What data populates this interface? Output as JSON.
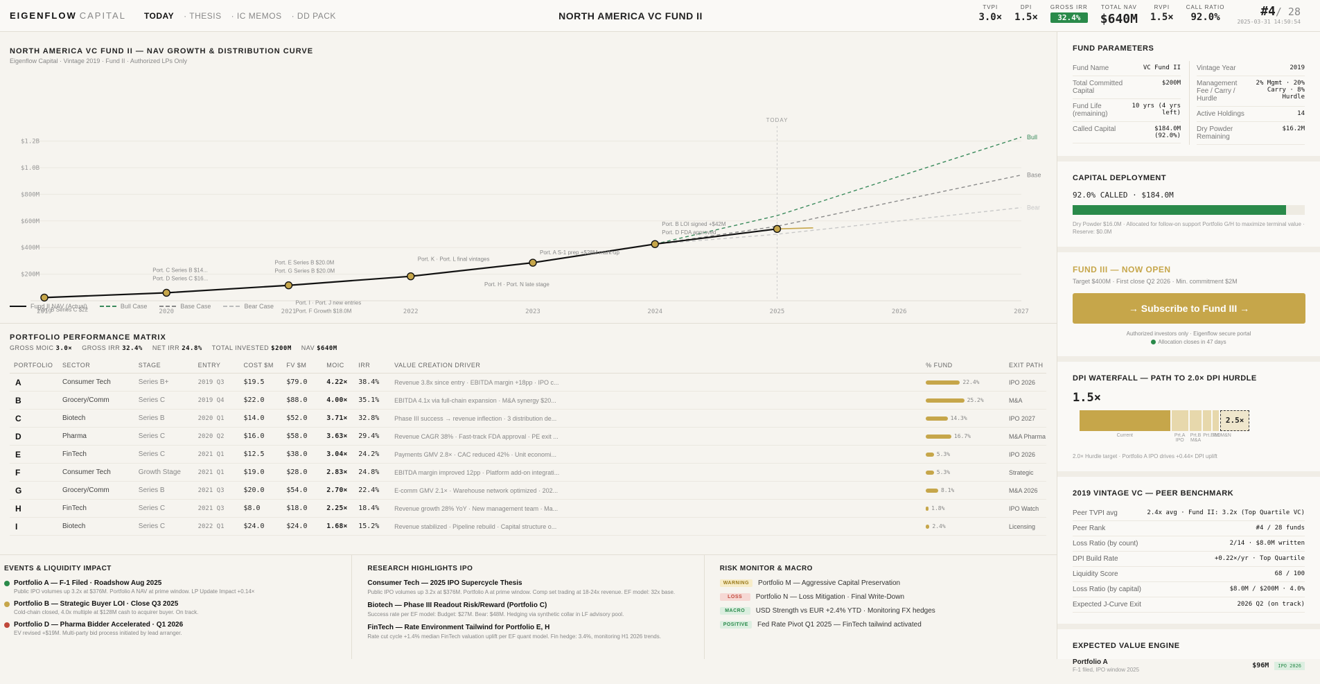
{
  "header": {
    "brand": "EIGENFLOW",
    "brand_sub": "CAPITAL",
    "nav": [
      "TODAY",
      "· THESIS",
      "· IC MEMOS",
      "· DD PACK"
    ],
    "fund_title": "NORTH AMERICA VC FUND II",
    "metrics": [
      {
        "label": "TVPI",
        "value": "3.0×"
      },
      {
        "label": "DPI",
        "value": "1.5×"
      },
      {
        "label": "GROSS IRR",
        "value": "32.4%"
      },
      {
        "label": "TOTAL NAV",
        "value": "$640M"
      },
      {
        "label": "RVPI",
        "value": "1.5×"
      },
      {
        "label": "CALL RATIO",
        "value": "92.0%"
      }
    ],
    "rank": "#4",
    "rank_of": "/ 28",
    "timestamp": "2025-03-31 14:50:54"
  },
  "chart": {
    "title": "NORTH AMERICA VC FUND II — NAV GROWTH & DISTRIBUTION CURVE",
    "subtitle": "Eigenflow Capital · Vintage 2019 · Fund II · Authorized LPs Only",
    "today_label": "TODAY",
    "legend": [
      "Fund II NAV (Actual)",
      "Bull Case",
      "Base Case",
      "Bear Case"
    ]
  },
  "chart_data": {
    "type": "line",
    "x": [
      2019,
      2020,
      2021,
      2022,
      2023,
      2024,
      2025
    ],
    "series": [
      {
        "name": "Fund II NAV (Actual)",
        "x": [
          2019,
          2020,
          2021,
          2022,
          2023,
          2024,
          2025
        ],
        "values": [
          24,
          60,
          116,
          184,
          286,
          426,
          540
        ]
      },
      {
        "name": "Bull",
        "x": [
          2024,
          2025,
          2027
        ],
        "values": [
          426,
          640,
          1230
        ]
      },
      {
        "name": "Base",
        "x": [
          2024,
          2025,
          2027
        ],
        "values": [
          426,
          560,
          945
        ]
      },
      {
        "name": "Bear",
        "x": [
          2024,
          2025,
          2027
        ],
        "values": [
          426,
          500,
          700
        ]
      }
    ],
    "yticks": [
      "$200M",
      "$400M",
      "$600M",
      "$800M",
      "$1.0B",
      "$1.2B"
    ],
    "ytick_values": [
      200,
      400,
      600,
      800,
      1000,
      1200
    ],
    "xticks": [
      "2019",
      "2020",
      "2021",
      "2022",
      "2023",
      "2024",
      "2025",
      "2026",
      "2027"
    ],
    "xlim": [
      2019,
      2027
    ],
    "ylim": [
      0,
      1250
    ],
    "today_x": 2025,
    "annotations": [
      {
        "x": 2019,
        "lines": [
          "Port. B Series C $22"
        ],
        "side": "below"
      },
      {
        "x": 2020,
        "lines": [
          "Port. C Series B $14...",
          "Port. D Series C $16..."
        ],
        "side": "above"
      },
      {
        "x": 2021,
        "lines": [
          "Port. E Series B $20.0M",
          "Port. G Series B $20.0M"
        ],
        "side": "above"
      },
      {
        "x": 2021,
        "lines": [
          "Port. I · Port. J new entries",
          "Port. F Growth $18.0M"
        ],
        "side": "below"
      },
      {
        "x": 2022,
        "lines": [
          "Port. K · Port. L final vintages"
        ],
        "side": "above"
      },
      {
        "x": 2023,
        "lines": [
          "Port. H · Port. N late stage"
        ],
        "side": "below"
      },
      {
        "x": 2023,
        "lines": [
          "Port. A S-1 prep +$28M mark-up"
        ],
        "side": "above"
      },
      {
        "x": 2024,
        "lines": [
          "Port. B LOI signed +$42M",
          "Port. D FDA approved"
        ],
        "side": "above"
      }
    ],
    "bull_label": "Bull",
    "base_label": "Base",
    "bear_label": "Bear"
  },
  "matrix": {
    "title": "PORTFOLIO PERFORMANCE MATRIX",
    "summary": [
      {
        "k": "GROSS MOIC",
        "v": "3.0×"
      },
      {
        "k": "GROSS IRR",
        "v": "32.4%"
      },
      {
        "k": "NET IRR",
        "v": "24.8%"
      },
      {
        "k": "TOTAL INVESTED",
        "v": "$200M"
      },
      {
        "k": "NAV",
        "v": "$640M"
      }
    ],
    "headers": [
      "PORTFOLIO",
      "SECTOR",
      "STAGE",
      "ENTRY",
      "COST $M",
      "FV $M",
      "MOIC",
      "IRR",
      "VALUE CREATION DRIVER",
      "% FUND",
      "EXIT PATH"
    ],
    "rows": [
      {
        "p": "A",
        "sector": "Consumer Tech",
        "stage": "Series B+",
        "entry": "2019 Q3",
        "cost": "$19.5",
        "fv": "$79.0",
        "moic": "4.22×",
        "irr": "38.4%",
        "driver": "Revenue 3.8x since entry · EBITDA margin +18pp · IPO c...",
        "pct": "22.4%",
        "pct_val": 22.4,
        "exit": "IPO 2026"
      },
      {
        "p": "B",
        "sector": "Grocery/Comm",
        "stage": "Series C",
        "entry": "2019 Q4",
        "cost": "$22.0",
        "fv": "$88.0",
        "moic": "4.00×",
        "irr": "35.1%",
        "driver": "EBITDA 4.1x via full-chain expansion · M&A synergy $20...",
        "pct": "25.2%",
        "pct_val": 25.2,
        "exit": "M&A"
      },
      {
        "p": "C",
        "sector": "Biotech",
        "stage": "Series B",
        "entry": "2020 Q1",
        "cost": "$14.0",
        "fv": "$52.0",
        "moic": "3.71×",
        "irr": "32.8%",
        "driver": "Phase III success → revenue inflection · 3 distribution de...",
        "pct": "14.3%",
        "pct_val": 14.3,
        "exit": "IPO 2027"
      },
      {
        "p": "D",
        "sector": "Pharma",
        "stage": "Series C",
        "entry": "2020 Q2",
        "cost": "$16.0",
        "fv": "$58.0",
        "moic": "3.63×",
        "irr": "29.4%",
        "driver": "Revenue CAGR 38% · Fast-track FDA approval · PE exit ...",
        "pct": "16.7%",
        "pct_val": 16.7,
        "exit": "M&A Pharma"
      },
      {
        "p": "E",
        "sector": "FinTech",
        "stage": "Series C",
        "entry": "2021 Q1",
        "cost": "$12.5",
        "fv": "$38.0",
        "moic": "3.04×",
        "irr": "24.2%",
        "driver": "Payments GMV 2.8× · CAC reduced 42% · Unit economi...",
        "pct": "5.3%",
        "pct_val": 5.3,
        "exit": "IPO 2026"
      },
      {
        "p": "F",
        "sector": "Consumer Tech",
        "stage": "Growth Stage",
        "entry": "2021 Q1",
        "cost": "$19.0",
        "fv": "$28.0",
        "moic": "2.83×",
        "irr": "24.8%",
        "driver": "EBITDA margin improved 12pp · Platform add-on integrati...",
        "pct": "5.3%",
        "pct_val": 5.3,
        "exit": "Strategic"
      },
      {
        "p": "G",
        "sector": "Grocery/Comm",
        "stage": "Series B",
        "entry": "2021 Q3",
        "cost": "$20.0",
        "fv": "$54.0",
        "moic": "2.70×",
        "irr": "22.4%",
        "driver": "E-comm GMV 2.1× · Warehouse network optimized · 202...",
        "pct": "8.1%",
        "pct_val": 8.1,
        "exit": "M&A 2026"
      },
      {
        "p": "H",
        "sector": "FinTech",
        "stage": "Series C",
        "entry": "2021 Q3",
        "cost": "$8.0",
        "fv": "$18.0",
        "moic": "2.25×",
        "irr": "18.4%",
        "driver": "Revenue growth 28% YoY · New management team · Ma...",
        "pct": "1.8%",
        "pct_val": 1.8,
        "exit": "IPO Watch"
      },
      {
        "p": "I",
        "sector": "Biotech",
        "stage": "Series C",
        "entry": "2022 Q1",
        "cost": "$24.0",
        "fv": "$24.0",
        "moic": "1.68×",
        "irr": "15.2%",
        "driver": "Revenue stabilized · Pipeline rebuild · Capital structure o...",
        "pct": "2.4%",
        "pct_val": 2.4,
        "exit": "Licensing"
      }
    ]
  },
  "events": {
    "title": "EVENTS & LIQUIDITY IMPACT",
    "items": [
      {
        "color": "#2a8a4a",
        "t": "Portfolio A — F-1 Filed · Roadshow Aug 2025",
        "s": "Public IPO volumes up 3.2x at $376M. Portfolio A NAV at prime window. LP Update Impact +0.14×"
      },
      {
        "color": "#c6a64a",
        "t": "Portfolio B — Strategic Buyer LOI · Close Q3 2025",
        "s": "Cold-chain closed, 4.0x multiple at $128M cash to acquirer buyer. On track."
      },
      {
        "color": "#c0483a",
        "t": "Portfolio D — Pharma Bidder Accelerated · Q1 2026",
        "s": "EV revised +$19M. Multi-party bid process initiated by lead arranger."
      }
    ]
  },
  "research": {
    "title": "RESEARCH HIGHLIGHTS IPO",
    "items": [
      {
        "t": "Consumer Tech — 2025 IPO Supercycle Thesis",
        "s": "Public IPO volumes up 3.2x at $376M. Portfolio A at prime window. Comp set trading at 18-24x revenue. EF model: 32x base."
      },
      {
        "t": "Biotech — Phase III Readout Risk/Reward (Portfolio C)",
        "s": "Success rate per EF model: Budget: $27M. Bear: $48M. Hedging via synthetic collar in LF advisory pool."
      },
      {
        "t": "FinTech — Rate Environment Tailwind for Portfolio E, H",
        "s": "Rate cut cycle +1.4% median FinTech valuation uplift per EF quant model. Fin hedge: 3.4%, monitoring H1 2026 trends."
      }
    ]
  },
  "risk": {
    "title": "RISK MONITOR & MACRO",
    "items": [
      {
        "tag": "WARNING",
        "bg": "#f7ecc8",
        "fg": "#9a7a1a",
        "t": "Portfolio M — Aggressive Capital Preservation"
      },
      {
        "tag": "LOSS",
        "bg": "#f6d8d4",
        "fg": "#c0483a",
        "t": "Portfolio N — Loss Mitigation · Final Write-Down"
      },
      {
        "tag": "MACRO",
        "bg": "#dceee0",
        "fg": "#2a8a4a",
        "t": "USD Strength vs EUR +2.4% YTD · Monitoring FX hedges"
      },
      {
        "tag": "POSITIVE",
        "bg": "#dceee0",
        "fg": "#2a8a4a",
        "t": "Fed Rate Pivot Q1 2025 — FinTech tailwind activated"
      }
    ]
  },
  "params": {
    "title": "FUND PARAMETERS",
    "left": [
      {
        "k": "Fund Name",
        "v": "VC Fund II"
      },
      {
        "k": "Total Committed Capital",
        "v": "$200M"
      },
      {
        "k": "Fund Life (remaining)",
        "v": "10 yrs (4 yrs left)"
      },
      {
        "k": "Called Capital",
        "v": "$184.0M (92.0%)"
      }
    ],
    "right": [
      {
        "k": "Vintage Year",
        "v": "2019"
      },
      {
        "k": "Management Fee / Carry / Hurdle",
        "v": "2% Mgmt · 20% Carry · 8% Hurdle"
      },
      {
        "k": "Active Holdings",
        "v": "14"
      },
      {
        "k": "Dry Powder Remaining",
        "v": "$16.2M"
      }
    ]
  },
  "deployment": {
    "title": "CAPITAL DEPLOYMENT",
    "label": "92.0% CALLED · $184.0M",
    "pct": 92,
    "note": "Dry Powder $16.0M · Allocated for follow-on support Portfolio G/H to maximize terminal value · Reserve: $0.0M"
  },
  "fund3": {
    "title": "FUND III — NOW OPEN",
    "sub": "Target $400M · First close Q2 2026 · Min. commitment $2M",
    "button": "→ Subscribe to Fund III →",
    "auth": "Authorized investors only · Eigenflow secure portal",
    "alloc": "Allocation closes in 47 days"
  },
  "dpi": {
    "title": "DPI WATERFALL — PATH TO 2.0× DPI HURDLE",
    "value": "1.5×",
    "target_label": "2.5×",
    "segments": [
      {
        "w": 1.5,
        "label": "Current"
      },
      {
        "w": 0.28,
        "label": "Prt.A IPO"
      },
      {
        "w": 0.2,
        "label": "Prt.B M&A"
      },
      {
        "w": 0.14,
        "label": "Prt.E&D"
      },
      {
        "w": 0.1,
        "label": "Prt.M&N"
      }
    ],
    "note": "2.0× Hurdle target · Portfolio A IPO drives +0.44× DPI uplift"
  },
  "bench": {
    "title": "2019 VINTAGE VC — PEER BENCHMARK",
    "rows": [
      {
        "k": "Peer TVPI avg",
        "v": "2.4x avg · Fund II: 3.2x (Top Quartile VC)"
      },
      {
        "k": "Peer Rank",
        "v": "#4 / 28 funds"
      },
      {
        "k": "Loss Ratio (by count)",
        "v": "2/14 · $8.0M written"
      },
      {
        "k": "DPI Build Rate",
        "v": "+0.22×/yr · Top Quartile"
      },
      {
        "k": "Liquidity Score",
        "v": "68 / 100"
      },
      {
        "k": "Loss Ratio (by capital)",
        "v": "$8.0M / $200M · 4.0%"
      },
      {
        "k": "Expected J-Curve Exit",
        "v": "2026 Q2 (on track)"
      }
    ]
  },
  "ev_engine": {
    "title": "EXPECTED VALUE ENGINE",
    "name": "Portfolio A",
    "sub": "F-1 filed, IPO window 2025",
    "value": "$96M",
    "tag": "IPO 2026"
  }
}
